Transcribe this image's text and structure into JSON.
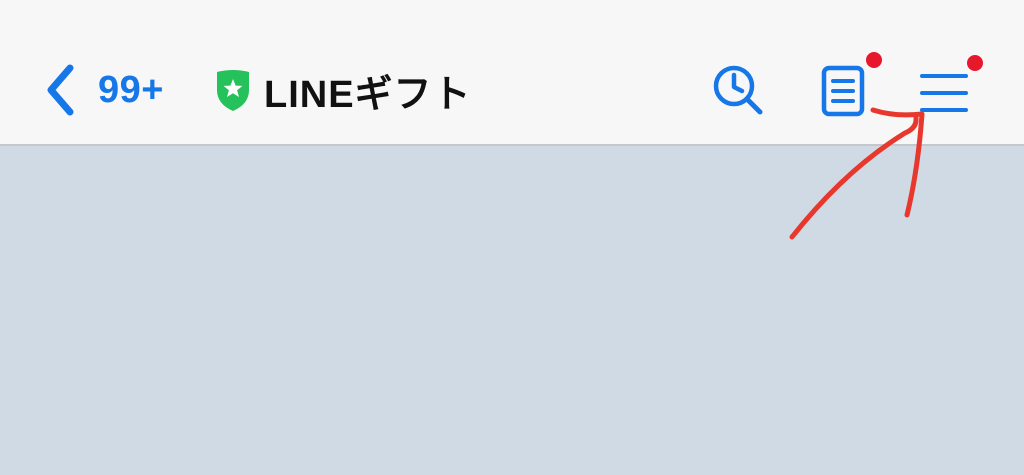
{
  "header": {
    "back_count": "99+",
    "title": "LINEギフト",
    "icons": {
      "back": "chevron-left-icon",
      "verified": "shield-star-icon",
      "search": "clock-search-icon",
      "notes": "notes-icon",
      "menu": "hamburger-menu-icon"
    },
    "badges": {
      "notes": "new",
      "menu": "new"
    }
  },
  "colors": {
    "accent": "#1677e8",
    "badge": "#e8182c",
    "verified": "#25c15a",
    "header_bg": "#f7f7f7",
    "chat_bg": "#d0dae4",
    "annotation": "#e8372c"
  }
}
